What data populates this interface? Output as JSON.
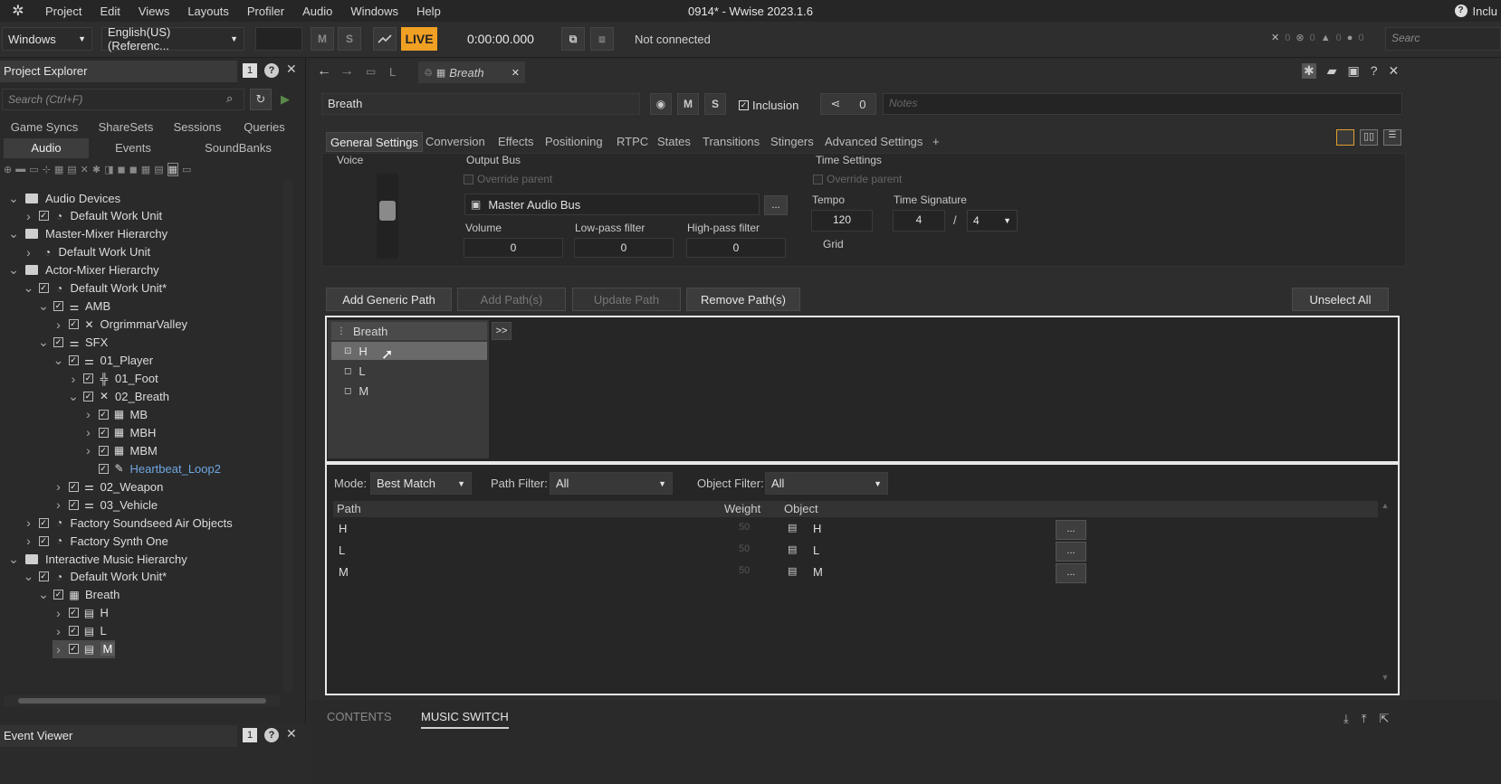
{
  "menubar": {
    "items": [
      "Project",
      "Edit",
      "Views",
      "Layouts",
      "Profiler",
      "Audio",
      "Windows",
      "Help"
    ],
    "title": "0914* - Wwise 2023.1.6",
    "right_label": "Inclu"
  },
  "toolbar": {
    "platform": "Windows",
    "language": "English(US) (Referenc...",
    "m_label": "M",
    "s_label": "S",
    "live_label": "LIVE",
    "time": "0:00:00.000",
    "status": "Not connected",
    "search_placeholder": "Searc",
    "counts": [
      "0",
      "0",
      "0",
      "0",
      "0"
    ]
  },
  "project_explorer": {
    "title": "Project Explorer",
    "badge": "1",
    "search_placeholder": "Search (Ctrl+F)",
    "tabs_row1": [
      "Game Syncs",
      "ShareSets",
      "Sessions",
      "Queries"
    ],
    "tabs_row2": [
      "Audio",
      "Events",
      "SoundBanks"
    ],
    "tree": [
      {
        "label": "Audio Devices",
        "depth": 0,
        "type": "folder",
        "expand": "v"
      },
      {
        "label": "Default Work Unit",
        "depth": 1,
        "type": "wu",
        "expand": ">",
        "check": true
      },
      {
        "label": "Master-Mixer Hierarchy",
        "depth": 0,
        "type": "folder",
        "expand": "v"
      },
      {
        "label": "Default Work Unit",
        "depth": 1,
        "type": "wu",
        "expand": ">",
        "check": false
      },
      {
        "label": "Actor-Mixer Hierarchy",
        "depth": 0,
        "type": "folder",
        "expand": "v"
      },
      {
        "label": "Default Work Unit*",
        "depth": 1,
        "type": "wu",
        "expand": "v",
        "check": true
      },
      {
        "label": "AMB",
        "depth": 2,
        "type": "mixer",
        "expand": "v",
        "check": true
      },
      {
        "label": "OrgrimmarValley",
        "depth": 3,
        "type": "switch",
        "expand": ">",
        "check": true
      },
      {
        "label": "SFX",
        "depth": 2,
        "type": "mixer",
        "expand": "v",
        "check": true
      },
      {
        "label": "01_Player",
        "depth": 3,
        "type": "mixer",
        "expand": "v",
        "check": true
      },
      {
        "label": "01_Foot",
        "depth": 4,
        "type": "blend",
        "expand": ">",
        "check": true
      },
      {
        "label": "02_Breath",
        "depth": 4,
        "type": "switch",
        "expand": "v",
        "check": true
      },
      {
        "label": "MB",
        "depth": 5,
        "type": "random",
        "expand": ">",
        "check": true
      },
      {
        "label": "MBH",
        "depth": 5,
        "type": "random",
        "expand": ">",
        "check": true
      },
      {
        "label": "MBM",
        "depth": 5,
        "type": "random",
        "expand": ">",
        "check": true
      },
      {
        "label": "Heartbeat_Loop2",
        "depth": 5,
        "type": "sound",
        "expand": "",
        "check": true,
        "link": true
      },
      {
        "label": "02_Weapon",
        "depth": 3,
        "type": "mixer",
        "expand": ">",
        "check": true
      },
      {
        "label": "03_Vehicle",
        "depth": 3,
        "type": "mixer",
        "expand": ">",
        "check": true
      },
      {
        "label": "Factory Soundseed Air Objects",
        "depth": 1,
        "type": "wu",
        "expand": ">",
        "check": true
      },
      {
        "label": "Factory Synth One",
        "depth": 1,
        "type": "wu",
        "expand": ">",
        "check": true
      },
      {
        "label": "Interactive Music Hierarchy",
        "depth": 0,
        "type": "folder",
        "expand": "v"
      },
      {
        "label": "Default Work Unit*",
        "depth": 1,
        "type": "wu",
        "expand": "v",
        "check": true
      },
      {
        "label": "Breath",
        "depth": 2,
        "type": "musicswitch",
        "expand": "v",
        "check": true
      },
      {
        "label": "H",
        "depth": 3,
        "type": "playlist",
        "expand": ">",
        "check": true
      },
      {
        "label": "L",
        "depth": 3,
        "type": "playlist",
        "expand": ">",
        "check": true
      },
      {
        "label": "M",
        "depth": 3,
        "type": "playlist",
        "expand": ">",
        "check": true,
        "selected": true
      }
    ]
  },
  "event_viewer": {
    "title": "Event Viewer",
    "badge": "1"
  },
  "editor": {
    "nav_tab_label": "L",
    "tab_label": "Breath",
    "object_name": "Breath",
    "m_label": "M",
    "s_label": "S",
    "inclusion_label": "Inclusion",
    "share_count": "0",
    "notes_placeholder": "Notes",
    "tabs": [
      "General Settings",
      "Conversion",
      "Effects",
      "Positioning",
      "RTPC",
      "States",
      "Transitions",
      "Stingers",
      "Advanced Settings",
      "+"
    ],
    "voice_label": "Voice",
    "output_bus_label": "Output Bus",
    "override_parent_label": "Override parent",
    "bus_name": "Master Audio Bus",
    "bus_btn": "...",
    "volume_label": "Volume",
    "volume_value": "0",
    "lowpass_label": "Low-pass filter",
    "lowpass_value": "0",
    "highpass_label": "High-pass filter",
    "highpass_value": "0",
    "time_settings_label": "Time Settings",
    "time_override_label": "Override parent",
    "tempo_label": "Tempo",
    "tempo_value": "120",
    "timesig_label": "Time Signature",
    "timesig_num": "4",
    "timesig_sep": "/",
    "timesig_den": "4",
    "grid_label": "Grid"
  },
  "paths": {
    "add_generic": "Add Generic Path",
    "add_paths": "Add Path(s)",
    "update_path": "Update Path",
    "remove_paths": "Remove Path(s)",
    "unselect_all": "Unselect All",
    "tree_root": "Breath",
    "expand_btn": ">>",
    "tree_items": [
      "H",
      "L",
      "M"
    ],
    "mode_label": "Mode:",
    "mode_value": "Best Match",
    "path_filter_label": "Path Filter:",
    "path_filter_value": "All",
    "object_filter_label": "Object Filter:",
    "object_filter_value": "All",
    "columns": [
      "Path",
      "Weight",
      "Object"
    ],
    "rows": [
      {
        "path": "H",
        "weight": "50",
        "object": "H",
        "btn": "..."
      },
      {
        "path": "L",
        "weight": "50",
        "object": "L",
        "btn": "..."
      },
      {
        "path": "M",
        "weight": "50",
        "object": "M",
        "btn": "..."
      }
    ]
  },
  "bottom_tabs": [
    "CONTENTS",
    "MUSIC SWITCH"
  ]
}
